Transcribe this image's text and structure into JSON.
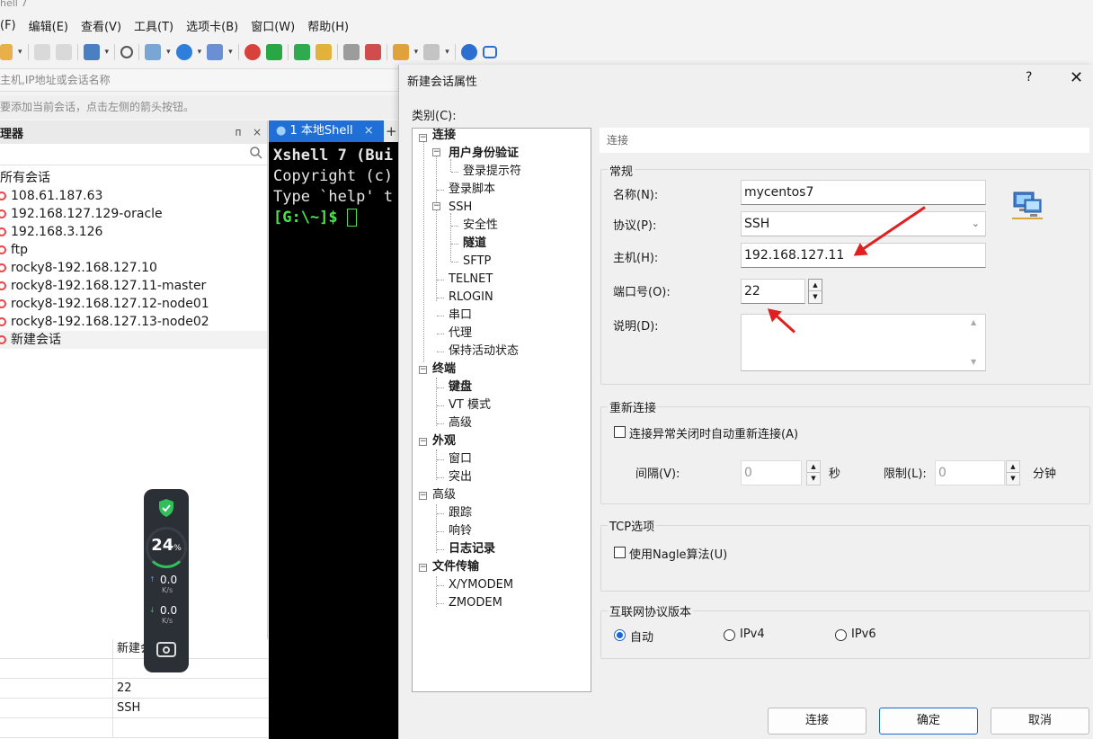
{
  "window": {
    "title": "hell 7"
  },
  "menu": [
    "(F)",
    "编辑(E)",
    "查看(V)",
    "工具(T)",
    "选项卡(B)",
    "窗口(W)",
    "帮助(H)"
  ],
  "address_bar": {
    "placeholder": "主机,IP地址或会话名称"
  },
  "hint_bar": {
    "text": "要添加当前会话，点击左侧的箭头按钮。"
  },
  "session_manager": {
    "title": "理器",
    "pin": "ᴨ",
    "close": "×",
    "root": "所有会话",
    "sessions": [
      "108.61.187.63",
      "192.168.127.129-oracle",
      "192.168.3.126",
      "ftp",
      "rocky8-192.168.127.10",
      "rocky8-192.168.127.11-master",
      "rocky8-192.168.127.12-node01",
      "rocky8-192.168.127.13-node02",
      "新建会话"
    ]
  },
  "properties_table": {
    "rows": [
      [
        "",
        "新建会"
      ],
      [
        "",
        ""
      ],
      [
        "",
        "22"
      ],
      [
        "",
        "SSH"
      ],
      [
        "",
        ""
      ]
    ]
  },
  "system_widget": {
    "cpu": "24",
    "cpu_unit": "%",
    "up": "0.0",
    "down": "0.0",
    "rate_unit": "K/s"
  },
  "terminal": {
    "tab_label": "1 本地Shell",
    "tab_close": "×",
    "plus": "+",
    "lines": [
      "Xshell 7 (Bui",
      "Copyright (c)",
      "",
      "Type `help' t"
    ],
    "prompt": "[G:\\~]$ "
  },
  "dialog": {
    "title": "新建会话属性",
    "help": "?",
    "close": "✕",
    "category_label": "类别(C):",
    "tree": [
      {
        "label": "连接",
        "bold": true
      },
      {
        "label": "用户身份验证",
        "bold": true
      },
      {
        "label": "登录提示符",
        "bold": false
      },
      {
        "label": "登录脚本",
        "bold": false
      },
      {
        "label": "SSH",
        "bold": false
      },
      {
        "label": "安全性",
        "bold": false
      },
      {
        "label": "隧道",
        "bold": true
      },
      {
        "label": "SFTP",
        "bold": false
      },
      {
        "label": "TELNET",
        "bold": false
      },
      {
        "label": "RLOGIN",
        "bold": false
      },
      {
        "label": "串口",
        "bold": false
      },
      {
        "label": "代理",
        "bold": false
      },
      {
        "label": "保持活动状态",
        "bold": false
      },
      {
        "label": "终端",
        "bold": true
      },
      {
        "label": "键盘",
        "bold": true
      },
      {
        "label": "VT 模式",
        "bold": false
      },
      {
        "label": "高级",
        "bold": false
      },
      {
        "label": "外观",
        "bold": true
      },
      {
        "label": "窗口",
        "bold": false
      },
      {
        "label": "突出",
        "bold": false
      },
      {
        "label": "高级",
        "bold": false
      },
      {
        "label": "跟踪",
        "bold": false
      },
      {
        "label": "响铃",
        "bold": false
      },
      {
        "label": "日志记录",
        "bold": true
      },
      {
        "label": "文件传输",
        "bold": true
      },
      {
        "label": "X/YMODEM",
        "bold": false
      },
      {
        "label": "ZMODEM",
        "bold": false
      }
    ],
    "breadcrumb": "连接",
    "general": {
      "group_title": "常规",
      "name_label": "名称(N):",
      "name_value": "mycentos7",
      "protocol_label": "协议(P):",
      "protocol_value": "SSH",
      "host_label": "主机(H):",
      "host_value": "192.168.127.11",
      "port_label": "端口号(O):",
      "port_value": "22",
      "desc_label": "说明(D):",
      "desc_value": ""
    },
    "reconnect": {
      "group_title": "重新连接",
      "auto_label": "连接异常关闭时自动重新连接(A)",
      "interval_label": "间隔(V):",
      "interval_value": "0",
      "interval_unit": "秒",
      "limit_label": "限制(L):",
      "limit_value": "0",
      "limit_unit": "分钟"
    },
    "tcp": {
      "group_title": "TCP选项",
      "nagle_label": "使用Nagle算法(U)"
    },
    "ip_version": {
      "group_title": "互联网协议版本",
      "options": [
        "自动",
        "IPv4",
        "IPv6"
      ],
      "selected": "自动"
    },
    "buttons": {
      "connect": "连接",
      "ok": "确定",
      "cancel": "取消"
    }
  },
  "colors": {
    "accent": "#1a66d2",
    "annotation_arrow": "#e02020",
    "terminal_prompt": "#4ee04e"
  }
}
